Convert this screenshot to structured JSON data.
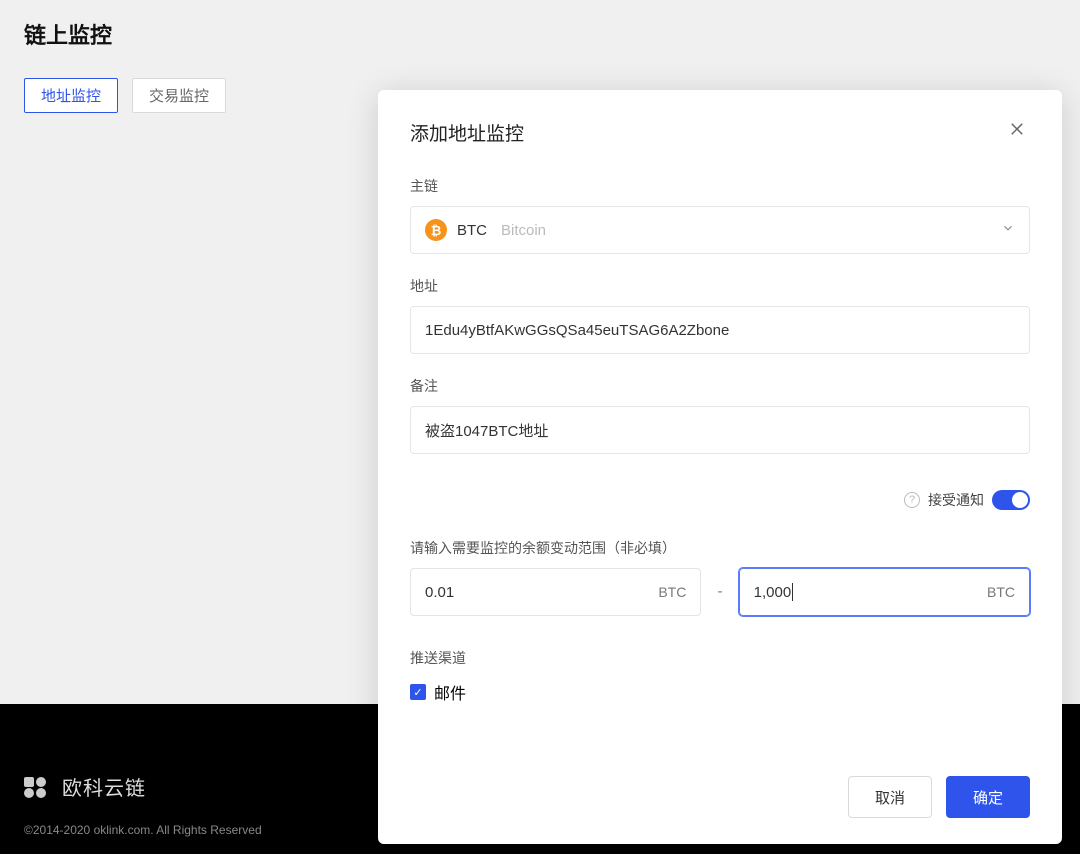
{
  "page": {
    "title": "链上监控"
  },
  "tabs": {
    "address": "地址监控",
    "transaction": "交易监控"
  },
  "footer": {
    "brand": "欧科云链",
    "copyright": "©2014-2020 oklink.com. All Rights Reserved"
  },
  "modal": {
    "title": "添加地址监控",
    "labels": {
      "chain": "主链",
      "address": "地址",
      "remark": "备注",
      "notify": "接受通知",
      "range": "请输入需要监控的余额变动范围（非必填）",
      "channel": "推送渠道"
    },
    "chain": {
      "ticker": "BTC",
      "name": "Bitcoin",
      "icon_glyph": "₿"
    },
    "address_value": "1Edu4yBtfAKwGGsQSa45euTSAG6A2Zbone",
    "remark_value": "被盗1047BTC地址",
    "range": {
      "min": "0.01",
      "max": "1,000",
      "unit": "BTC",
      "separator": "-"
    },
    "channel_email": "邮件",
    "buttons": {
      "cancel": "取消",
      "confirm": "确定"
    }
  }
}
